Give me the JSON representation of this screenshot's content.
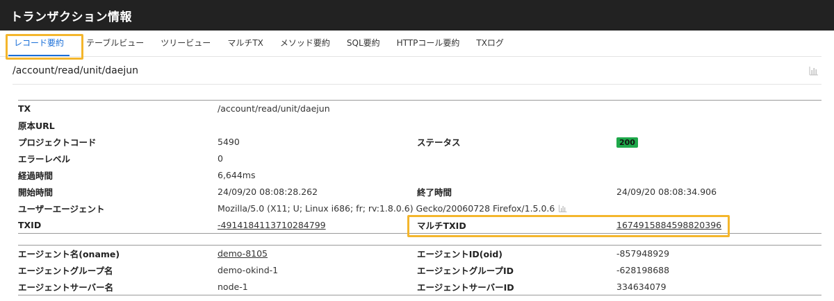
{
  "window": {
    "title": "トランザクション情報"
  },
  "tabs": [
    {
      "label": "レコード要約",
      "active": true
    },
    {
      "label": "テーブルビュー"
    },
    {
      "label": "ツリービュー"
    },
    {
      "label": "マルチTX"
    },
    {
      "label": "メソッド要約"
    },
    {
      "label": "SQL要約"
    },
    {
      "label": "HTTPコール要約"
    },
    {
      "label": "TXログ"
    }
  ],
  "path": "/account/read/unit/daejun",
  "icons": {
    "chart": "bar-chart-icon"
  },
  "colors": {
    "accent": "#1a6fd8",
    "highlight": "#f4b62c",
    "status_ok": "#1ea84a",
    "error": "#e03b3b",
    "titlebar": "#222222"
  },
  "record": {
    "tx_label": "TX",
    "tx_value": "/account/read/unit/daejun",
    "url_label": "原本URL",
    "url_value": "",
    "project_label": "プロジェクトコード",
    "project_value": "5490",
    "status_label": "ステータス",
    "status_value": "200",
    "error_label": "エラーレベル",
    "error_value": "0",
    "elapsed_label": "経過時間",
    "elapsed_value": "6,644ms",
    "start_label": "開始時間",
    "start_value": "24/09/20 08:08:28.262",
    "end_label": "終了時間",
    "end_value": "24/09/20 08:08:34.906",
    "ua_label": "ユーザーエージェント",
    "ua_value": "Mozilla/5.0 (X11; U; Linux i686; fr; rv:1.8.0.6) Gecko/20060728 Firefox/1.5.0.6",
    "txid_label": "TXID",
    "txid_value": "-4914184113710284799",
    "multi_txid_label": "マルチTXID",
    "multi_txid_value": "1674915884598820396"
  },
  "agent": {
    "oname_label": "エージェント名(oname)",
    "oname_value": "demo-8105",
    "oid_label": "エージェントID(oid)",
    "oid_value": "-857948929",
    "group_label": "エージェントグループ名",
    "group_value": "demo-okind-1",
    "group_id_label": "エージェントグループID",
    "group_id_value": "-628198688",
    "server_label": "エージェントサーバー名",
    "server_value": "node-1",
    "server_id_label": "エージェントサーバーID",
    "server_id_value": "334634079"
  }
}
